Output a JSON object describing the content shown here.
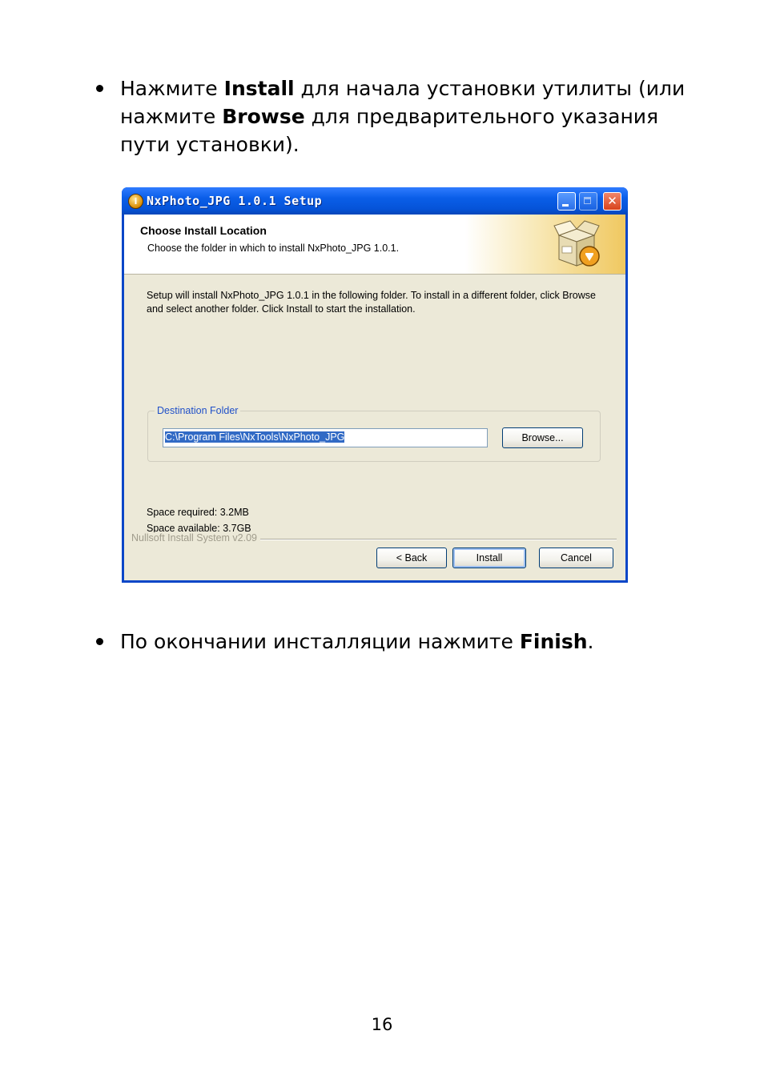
{
  "doc": {
    "bullet1": {
      "part1": "Нажмите ",
      "bold1": "Install",
      "part2": " для начала установки утилиты (или нажмите ",
      "bold2": "Browse",
      "part3": " для предварительного указания пути установки)."
    },
    "bullet2": {
      "part1": "По окончании инсталляции нажмите ",
      "bold1": "Finish",
      "part2": "."
    },
    "page_number": "16"
  },
  "dialog": {
    "title": "NxPhoto_JPG 1.0.1 Setup",
    "app_icon_glyph": "i",
    "close_glyph": "✕",
    "header": {
      "title": "Choose Install Location",
      "subtitle": "Choose the folder in which to install NxPhoto_JPG 1.0.1."
    },
    "description": "Setup will install NxPhoto_JPG 1.0.1 in the following folder. To install in a different folder, click Browse and select another folder. Click Install to start the installation.",
    "destination": {
      "legend": "Destination Folder",
      "path": "C:\\Program Files\\NxTools\\NxPhoto_JPG",
      "browse_label": "Browse..."
    },
    "space_required": "Space required: 3.2MB",
    "space_available": "Space available: 3.7GB",
    "branding": "Nullsoft Install System v2.09",
    "buttons": {
      "back": "< Back",
      "install": "Install",
      "cancel": "Cancel"
    }
  },
  "colors": {
    "titlebar": "#0a5ee8",
    "dialog_bg": "#ece9d8",
    "legend_text": "#2050c8",
    "selection": "#316ac5"
  }
}
